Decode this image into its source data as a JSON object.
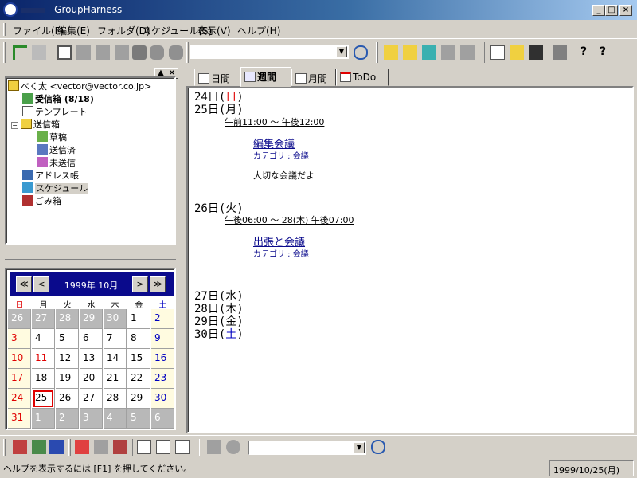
{
  "window": {
    "title": "- GroupHarness",
    "min": "_",
    "max": "□",
    "close": "×"
  },
  "menu": [
    "ファイル(F)",
    "編集(E)",
    "フォルダ(D)",
    "スケジュール(S)",
    "表示(V)",
    "ヘルプ(H)"
  ],
  "tree": {
    "root": "べく太 <vector@vector.co.jp>",
    "inbox": "受信箱 (8/18)",
    "template": "テンプレート",
    "outbox": "送信箱",
    "draft": "草稿",
    "sent": "送信済",
    "unsent": "未送信",
    "address": "アドレス帳",
    "schedule": "スケジュール",
    "trash": "ごみ箱",
    "expander": "−"
  },
  "calendar": {
    "title": "1999年 10月",
    "nav": [
      "≪",
      "<",
      ">",
      "≫"
    ],
    "dow": [
      "日",
      "月",
      "火",
      "水",
      "木",
      "金",
      "土"
    ],
    "cells": [
      [
        "26",
        "27",
        "28",
        "29",
        "30",
        "1",
        "2"
      ],
      [
        "3",
        "4",
        "5",
        "6",
        "7",
        "8",
        "9"
      ],
      [
        "10",
        "11",
        "12",
        "13",
        "14",
        "15",
        "16"
      ],
      [
        "17",
        "18",
        "19",
        "20",
        "21",
        "22",
        "23"
      ],
      [
        "24",
        "25",
        "26",
        "27",
        "28",
        "29",
        "30"
      ],
      [
        "31",
        "1",
        "2",
        "3",
        "4",
        "5",
        "6"
      ]
    ],
    "selected": "25"
  },
  "tabs": [
    "日間",
    "週間",
    "月間",
    "ToDo"
  ],
  "active_tab": "週間",
  "week": {
    "d24": {
      "a": "24日(",
      "b": "日",
      "c": ")"
    },
    "d25": "25日(月)",
    "t25": "午前11:00  〜  午後12:00",
    "e1_title": "編集会議",
    "e1_cat": "カテゴリ : 会議",
    "e1_note": "大切な会議だよ",
    "d26": "26日(火)",
    "t26": "午後06:00  〜  28(木) 午後07:00",
    "e2_title": "出張と会議",
    "e2_cat": "カテゴリ : 会議",
    "d27": "27日(水)",
    "d28": "28日(木)",
    "d29": "29日(金)",
    "d30": {
      "a": "30日(",
      "b": "土",
      "c": ")"
    }
  },
  "status": {
    "help": "ヘルプを表示するには [F1] を押してください。",
    "date": "1999/10/25(月)"
  },
  "colors": {
    "sunday": "#e00000",
    "saturday": "#0000c0",
    "title_bar": "#0a246a",
    "link": "#0a0a8c"
  }
}
